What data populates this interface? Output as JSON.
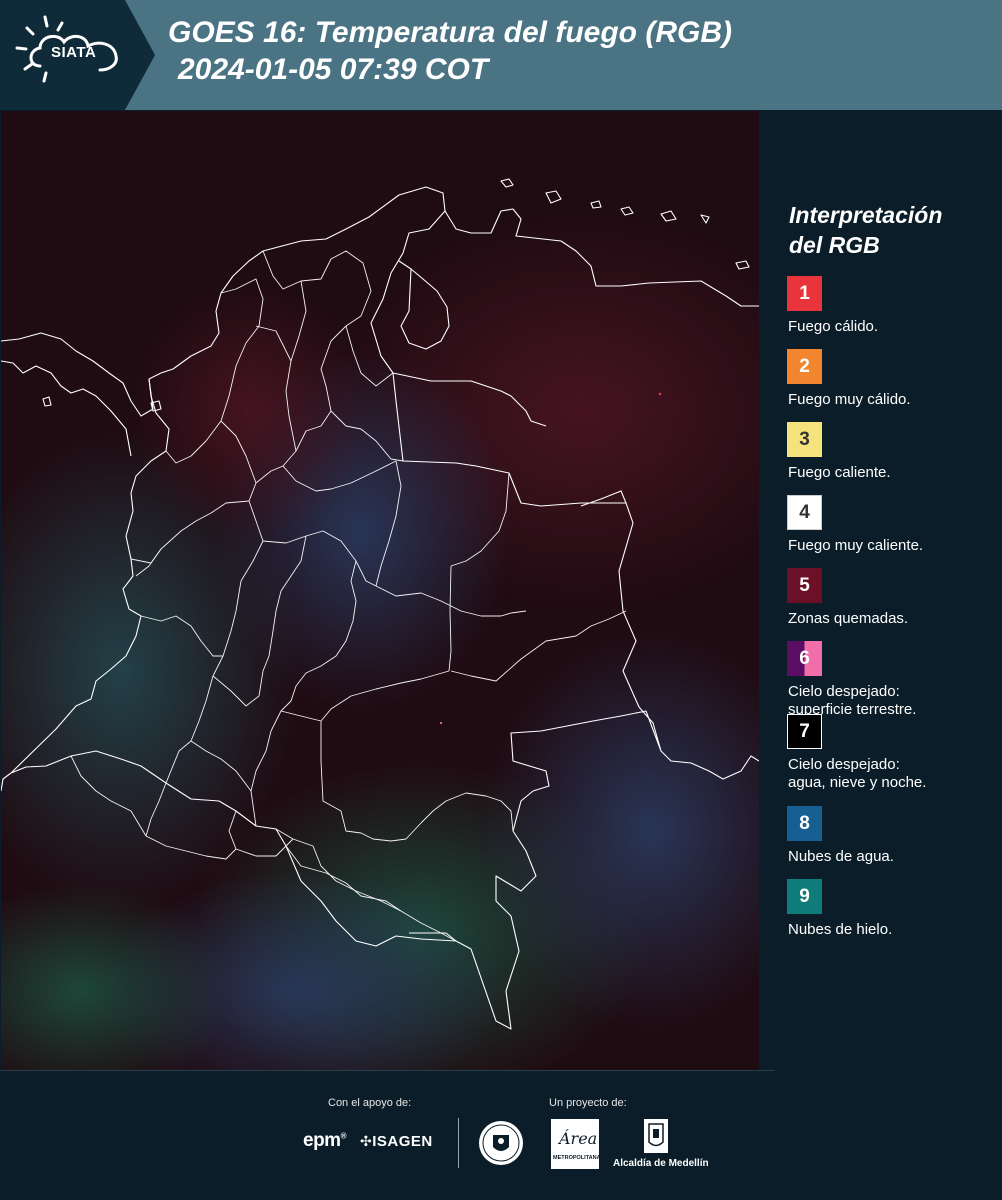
{
  "header": {
    "logo_text": "SIATA",
    "title_line1": "GOES 16: Temperatura del fuego (RGB)",
    "title_line2": "2024-01-05 07:39 COT"
  },
  "legend": {
    "title_line1": "Interpretación",
    "title_line2": "del RGB",
    "items": [
      {
        "number": "1",
        "label": "Fuego cálido.",
        "color": "#e8343a"
      },
      {
        "number": "2",
        "label": "Fuego muy cálido.",
        "color": "#f2862e"
      },
      {
        "number": "3",
        "label": "Fuego caliente.",
        "color": "#f6e27a"
      },
      {
        "number": "4",
        "label": "Fuego muy caliente.",
        "color": "#ffffff"
      },
      {
        "number": "5",
        "label": "Zonas quemadas.",
        "color": "#6b1026"
      },
      {
        "number": "6",
        "label_line1": "Cielo despejado:",
        "label_line2": "superficie terrestre.",
        "colors": [
          "#5a0d63",
          "#f06fa8"
        ]
      },
      {
        "number": "7",
        "label_line1": "Cielo despejado:",
        "label_line2": "agua, nieve y noche.",
        "color": "#000000"
      },
      {
        "number": "8",
        "label": "Nubes de agua.",
        "color": "#175e93"
      },
      {
        "number": "9",
        "label": "Nubes de hielo.",
        "color": "#0f7c7a"
      }
    ]
  },
  "footer": {
    "support_caption": "Con el apoyo de:",
    "project_caption": "Un proyecto de:",
    "epm_label": "epm",
    "isagen_label": "ISAGEN",
    "area_label": "Área",
    "area_sublabel": "METROPOLITANA",
    "alcaldia_label": "Alcaldía de Medellín"
  },
  "colors": {
    "header_bg": "#4a7384",
    "logo_bg": "#0f2a38",
    "page_bg": "#0b1d28",
    "map_base": "#1c0c12",
    "boundary": "#ffffff"
  }
}
